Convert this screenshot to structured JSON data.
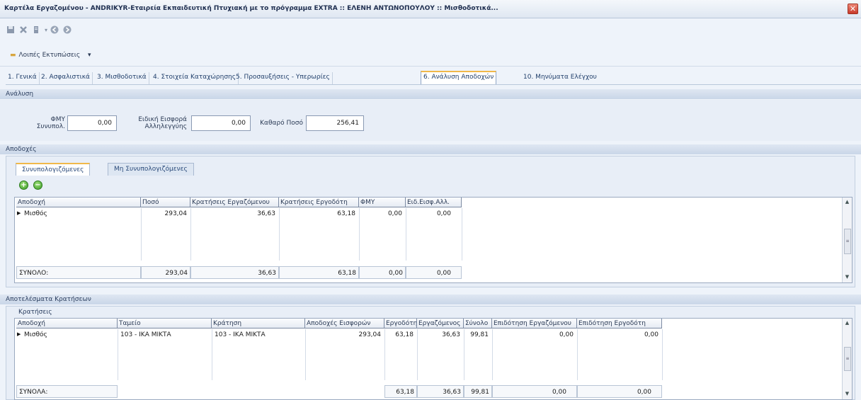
{
  "window": {
    "title": "Καρτέλα Εργαζομένου - ANDRIKYR-Εταιρεία Εκπαιδευτική Πτυχιακή με το πρόγραμμα EXTRA :: ΕΛΕΝΗ ΑΝΤΩΝΟΠΟΥΛΟΥ :: Μισθοδοτικά...",
    "close_glyph": "✕"
  },
  "toolbar": {
    "save_icon": "save-icon",
    "delete_icon": "delete-icon",
    "print_icon": "print-icon",
    "back_icon": "back-icon",
    "forward_icon": "forward-icon",
    "other_prints_label": "Λοιπές Εκτυπώσεις",
    "other_prints_arrow": "▾"
  },
  "tabs": [
    {
      "label": "1. Γενικά"
    },
    {
      "label": "2. Ασφαλιστικά"
    },
    {
      "label": "3. Μισθοδοτικά"
    },
    {
      "label": "4. Στοιχεία Καταχώρησης"
    },
    {
      "label": "5. Προσαυξήσεις - Υπερωρίες"
    },
    {
      "label": "6. Ανάλυση Αποδοχών"
    },
    {
      "label": "10. Μηνύματα Ελέγχου"
    }
  ],
  "analysis": {
    "header": "Ανάλυση",
    "fmy_label_1": "ΦΜΥ",
    "fmy_label_2": "Συνυπολ.",
    "fmy_value": "0,00",
    "solidarity_label_1": "Ειδική Εισφορά",
    "solidarity_label_2": "Αλληλεγγύης",
    "solidarity_value": "0,00",
    "net_label": "Καθαρό Ποσό",
    "net_value": "256,41"
  },
  "earnings": {
    "header": "Αποδοχές",
    "subtab_active": "Συνυπολογιζόμενες",
    "subtab_other": "Μη Συνυπολογιζόμενες",
    "add_glyph": "+",
    "remove_glyph": "−",
    "columns": [
      "Αποδοχή",
      "Ποσό",
      "Κρατήσεις Εργαζόμενου",
      "Κρατήσεις Εργοδότη",
      "ΦΜΥ",
      "Ειδ.Εισφ.Αλλ."
    ],
    "rows": [
      {
        "name": "Μισθός",
        "amount": "293,04",
        "emp_ded": "36,63",
        "er_ded": "63,18",
        "fmy": "0,00",
        "solidarity": "0,00"
      }
    ],
    "totals_label": "ΣΥΝΟΛΟ:",
    "totals": {
      "amount": "293,04",
      "emp_ded": "36,63",
      "er_ded": "63,18",
      "fmy": "0,00",
      "solidarity": "0,00"
    }
  },
  "deductions": {
    "header": "Αποτελέσματα Κρατήσεων",
    "caption": "Κρατήσεις",
    "columns": [
      "Αποδοχή",
      "Ταμείο",
      "Κράτηση",
      "Αποδοχές Εισφορών",
      "Εργοδότης",
      "Εργαζόμενος",
      "Σύνολο",
      "Επιδότηση Εργαζόμενου",
      "Επιδότηση Εργοδότη"
    ],
    "rows": [
      {
        "name": "Μισθός",
        "fund": "103 - ΙΚΑ ΜΙΚΤΑ",
        "deduction": "103 - ΙΚΑ ΜΙΚΤΑ",
        "base": "293,04",
        "employer": "63,18",
        "employee": "36,63",
        "total": "99,81",
        "sub_emp": "0,00",
        "sub_er": "0,00"
      }
    ],
    "totals_label": "ΣΥΝΟΛΑ:",
    "totals": {
      "employer": "63,18",
      "employee": "36,63",
      "total": "99,81",
      "sub_emp": "0,00",
      "sub_er": "0,00"
    }
  },
  "scroll": {
    "up": "▲",
    "down": "▼",
    "thumb": "≡"
  },
  "row_marker": "▶"
}
